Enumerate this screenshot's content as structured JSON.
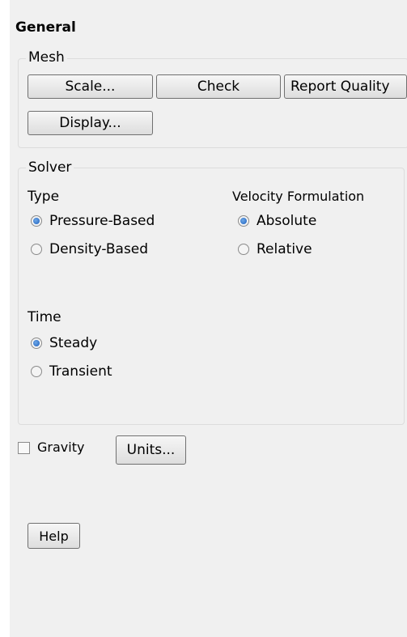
{
  "panel_title": "General",
  "mesh": {
    "legend": "Mesh",
    "scale_label": "Scale...",
    "check_label": "Check",
    "report_quality_label": "Report Quality",
    "display_label": "Display..."
  },
  "solver": {
    "legend": "Solver",
    "type": {
      "label": "Type",
      "options": [
        "Pressure-Based",
        "Density-Based"
      ],
      "selected": "Pressure-Based"
    },
    "velocity_formulation": {
      "label": "Velocity Formulation",
      "options": [
        "Absolute",
        "Relative"
      ],
      "selected": "Absolute"
    },
    "time": {
      "label": "Time",
      "options": [
        "Steady",
        "Transient"
      ],
      "selected": "Steady"
    }
  },
  "gravity": {
    "label": "Gravity",
    "checked": false
  },
  "units_label": "Units...",
  "help_label": "Help"
}
